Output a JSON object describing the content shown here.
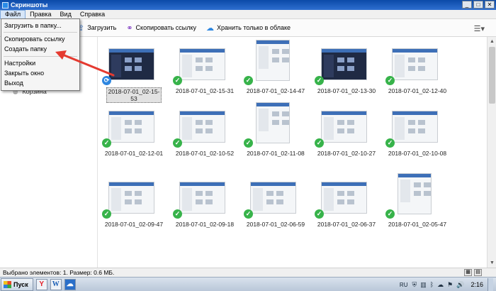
{
  "window": {
    "title": "Скриншоты",
    "controls": [
      "_",
      "□",
      "✕"
    ]
  },
  "menubar": [
    "Файл",
    "Правка",
    "Вид",
    "Справка"
  ],
  "toolbar": {
    "upload_label": "Загрузить",
    "copy_link_label": "Скопировать ссылку",
    "cloud_only_label": "Хранить только в облаке",
    "upload_icon": "upload-icon",
    "link_icon": "link-icon",
    "cloud_icon": "cloud-icon",
    "view_menu_icon": "list-view-icon"
  },
  "dropdown": {
    "items": [
      "Загрузить в папку...",
      "Скопировать ссылку",
      "Создать папку",
      "Настройки",
      "Закрыть окно",
      "Выход"
    ]
  },
  "sidebar": {
    "trash_label": "Корзина"
  },
  "files": [
    {
      "name": "2018-07-01_02-15-53",
      "status": "sync",
      "selected": true
    },
    {
      "name": "2018-07-01_02-15-31",
      "status": "ok"
    },
    {
      "name": "2018-07-01_02-14-47",
      "status": "ok"
    },
    {
      "name": "2018-07-01_02-13-30",
      "status": "ok"
    },
    {
      "name": "2018-07-01_02-12-40",
      "status": "ok"
    },
    {
      "name": "2018-07-01_02-12-01",
      "status": "ok"
    },
    {
      "name": "2018-07-01_02-10-52",
      "status": "ok"
    },
    {
      "name": "2018-07-01_02-11-08",
      "status": "ok"
    },
    {
      "name": "2018-07-01_02-10-27",
      "status": "ok"
    },
    {
      "name": "2018-07-01_02-10-08",
      "status": "ok"
    },
    {
      "name": "2018-07-01_02-09-47",
      "status": "ok"
    },
    {
      "name": "2018-07-01_02-09-18",
      "status": "ok"
    },
    {
      "name": "2018-07-01_02-06-59",
      "status": "ok"
    },
    {
      "name": "2018-07-01_02-06-37",
      "status": "ok"
    },
    {
      "name": "2018-07-01_02-05-47",
      "status": "ok"
    }
  ],
  "statusbar": {
    "text": "Выбрано элементов: 1. Размер: 0.6 МБ."
  },
  "taskbar": {
    "start_label": "Пуск",
    "lang": "RU",
    "clock": "2:16"
  },
  "colors": {
    "accent": "#2d86e0",
    "ok_badge": "#37b34a",
    "arrow": "#e53a30"
  }
}
